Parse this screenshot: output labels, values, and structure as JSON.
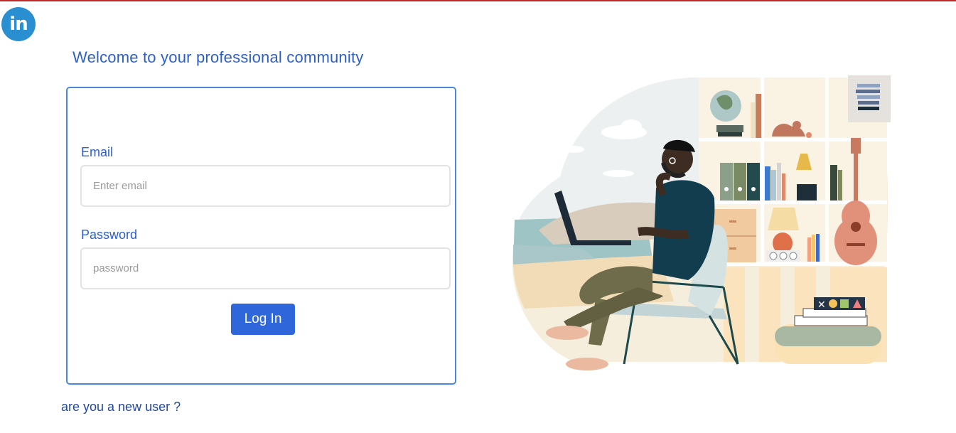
{
  "brand": {
    "logo_text": "in"
  },
  "login": {
    "heading": "Welcome to your professional community",
    "email_label": "Email",
    "email_placeholder": "Enter email",
    "password_label": "Password",
    "password_placeholder": "password",
    "submit_label": "Log In",
    "new_user_link": "are you a new user ?"
  },
  "colors": {
    "accent": "#2c5fc9",
    "button": "#2f66d9",
    "logo": "#2a8fd0",
    "top_border": "#c0282b"
  }
}
